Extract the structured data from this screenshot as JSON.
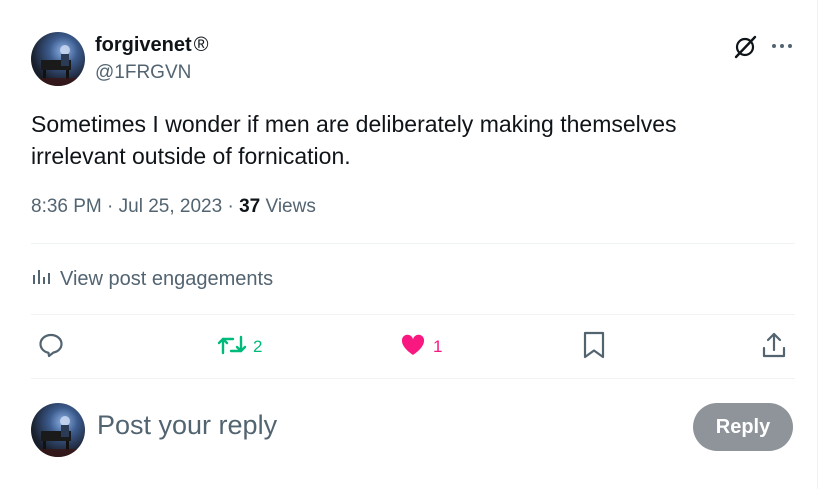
{
  "author": {
    "name": "forgivenet",
    "badge": "®",
    "handle": "@1FRGVN"
  },
  "tweet": {
    "text": "Sometimes I wonder if men are deliberately making themselves irrelevant outside of fornication."
  },
  "meta": {
    "time": "8:36 PM",
    "separator": "·",
    "date": "Jul 25, 2023",
    "views_count": "37",
    "views_label": "Views"
  },
  "engagements_label": "View post engagements",
  "actions": {
    "retweet_count": "2",
    "like_count": "1"
  },
  "reply_box": {
    "placeholder": "Post your reply",
    "button_label": "Reply"
  },
  "colors": {
    "text": "#0f1419",
    "secondary": "#536471",
    "retweet": "#00ba7c",
    "like": "#f91880",
    "reply_button_bg": "#8e9499"
  }
}
